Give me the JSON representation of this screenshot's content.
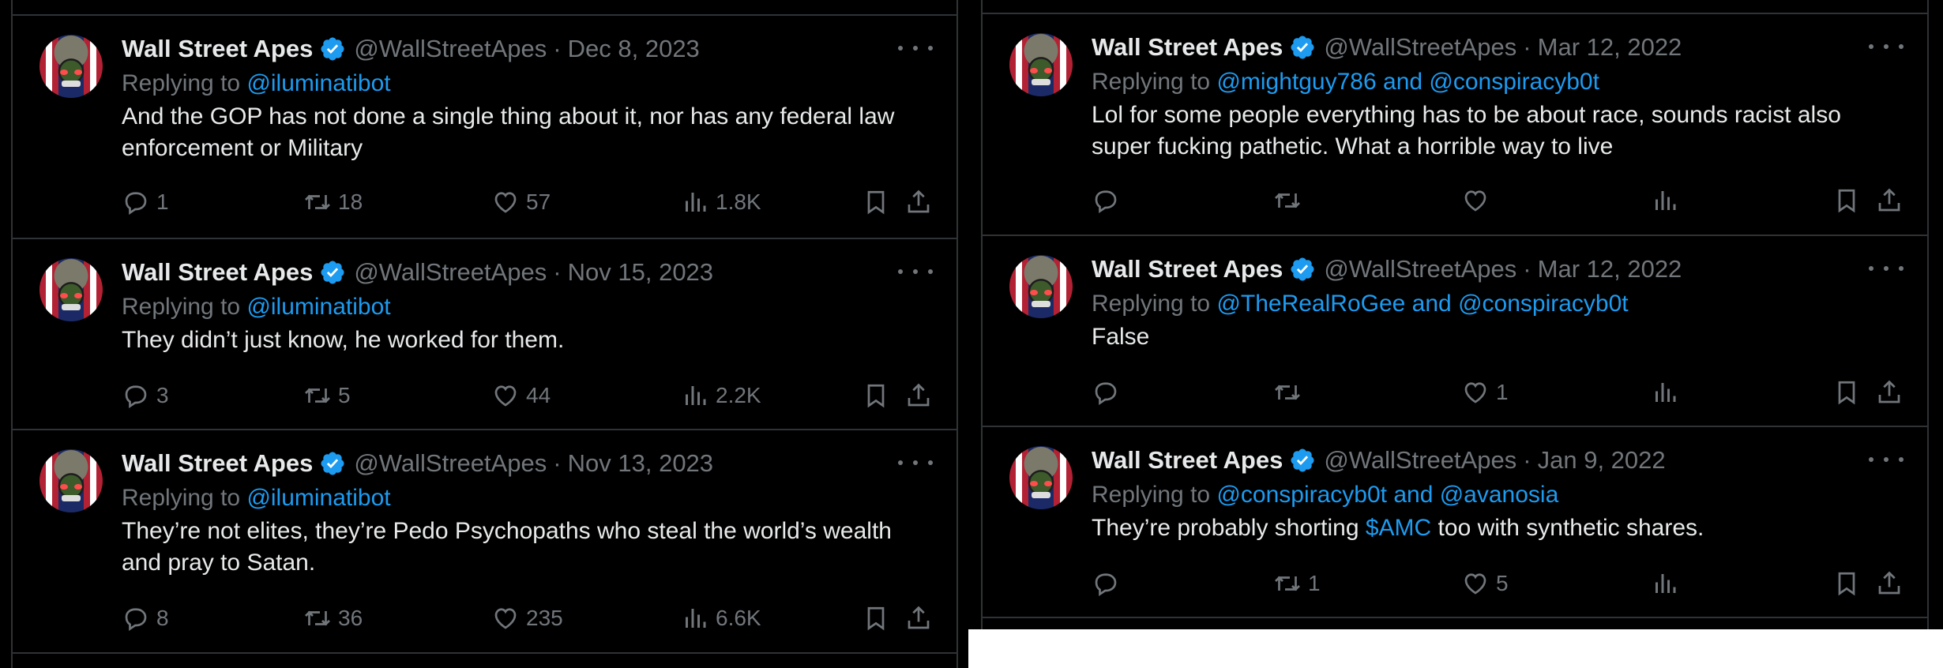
{
  "left_column": {
    "tweets": [
      {
        "name": "Wall Street Apes",
        "handle": "@WallStreetApes",
        "date": "Dec 8, 2023",
        "replying_prefix": "Replying to",
        "replying_to": "@iluminatibot",
        "text_lines": [
          "And the GOP has not done a single thing about it, nor has any federal law",
          "enforcement or Military"
        ],
        "replies": "1",
        "retweets": "18",
        "likes": "57",
        "views": "1.8K"
      },
      {
        "name": "Wall Street Apes",
        "handle": "@WallStreetApes",
        "date": "Nov 15, 2023",
        "replying_prefix": "Replying to",
        "replying_to": "@iluminatibot",
        "text_lines": [
          "They didn’t just know, he worked for them."
        ],
        "replies": "3",
        "retweets": "5",
        "likes": "44",
        "views": "2.2K"
      },
      {
        "name": "Wall Street Apes",
        "handle": "@WallStreetApes",
        "date": "Nov 13, 2023",
        "replying_prefix": "Replying to",
        "replying_to": "@iluminatibot",
        "text_lines": [
          "They’re not elites, they’re Pedo Psychopaths who steal the world’s wealth",
          "and pray to Satan."
        ],
        "replies": "8",
        "retweets": "36",
        "likes": "235",
        "views": "6.6K"
      }
    ]
  },
  "right_column": {
    "tweets": [
      {
        "name": "Wall Street Apes",
        "handle": "@WallStreetApes",
        "date": "Mar 12, 2022",
        "replying_prefix": "Replying to",
        "replying_to": "@mightguy786 and @conspiracyb0t",
        "text_lines": [
          "Lol for some people everything has to be about race, sounds racist also",
          "super fucking pathetic. What a horrible way to live"
        ],
        "replies": "",
        "retweets": "",
        "likes": "",
        "views": ""
      },
      {
        "name": "Wall Street Apes",
        "handle": "@WallStreetApes",
        "date": "Mar 12, 2022",
        "replying_prefix": "Replying to",
        "replying_to": "@TheRealRoGee and @conspiracyb0t",
        "text_lines": [
          "False"
        ],
        "replies": "",
        "retweets": "",
        "likes": "1",
        "views": ""
      },
      {
        "name": "Wall Street Apes",
        "handle": "@WallStreetApes",
        "date": "Jan 9, 2022",
        "replying_prefix": "Replying to",
        "replying_to": "@conspiracyb0t and @avanosia",
        "text_before": "They’re probably shorting ",
        "cashtag": "$AMC",
        "text_after": " too with synthetic shares.",
        "replies": "",
        "retweets": "1",
        "likes": "5",
        "views": ""
      }
    ]
  },
  "colors": {
    "background": "#000000",
    "text": "#e7e9ea",
    "muted": "#71767b",
    "link": "#1d9bf0",
    "border": "#2f3336"
  },
  "icons": [
    "verified-badge-icon",
    "more-icon",
    "reply-icon",
    "retweet-icon",
    "like-icon",
    "views-icon",
    "bookmark-icon",
    "share-icon"
  ]
}
